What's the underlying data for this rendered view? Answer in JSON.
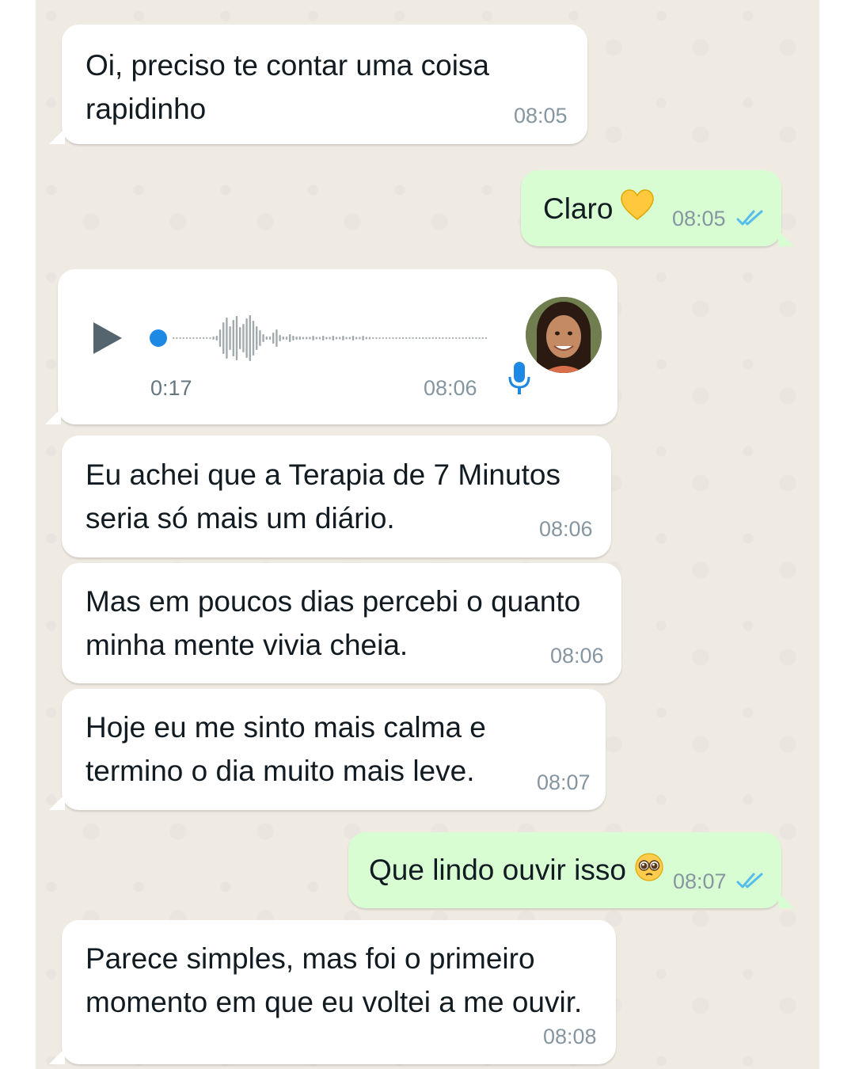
{
  "messages": [
    {
      "direction": "in",
      "text_lines": [
        "Oi, preciso te contar uma coisa",
        "rapidinho"
      ],
      "time": "08:05"
    },
    {
      "direction": "out",
      "text": "Claro",
      "emoji": "yellow-heart",
      "time": "08:05",
      "status": "read"
    },
    {
      "direction": "in",
      "type": "voice",
      "duration": "0:17",
      "time": "08:06"
    },
    {
      "direction": "in",
      "text_lines": [
        "Eu achei que a Terapia de 7 Minutos",
        "seria só mais um diário."
      ],
      "time": "08:06"
    },
    {
      "direction": "in",
      "text_lines": [
        "Mas em poucos dias percebi o quanto",
        "minha mente vivia cheia."
      ],
      "time": "08:06"
    },
    {
      "direction": "in",
      "text_lines": [
        "Hoje eu me sinto mais calma e",
        "termino o dia muito mais leve."
      ],
      "time": "08:07"
    },
    {
      "direction": "out",
      "text": "Que lindo ouvir isso",
      "emoji": "pleading-face",
      "time": "08:07",
      "status": "read"
    },
    {
      "direction": "in",
      "text_lines": [
        "Parece simples, mas foi o primeiro",
        "momento em que eu voltei a me ouvir."
      ],
      "time": "08:08"
    }
  ],
  "colors": {
    "background": "#efeae2",
    "incoming_bubble": "#ffffff",
    "outgoing_bubble": "#d9fdd3",
    "timestamp": "#8696a0",
    "read_ticks": "#53bdeb",
    "voice_accent": "#1e88e5"
  }
}
